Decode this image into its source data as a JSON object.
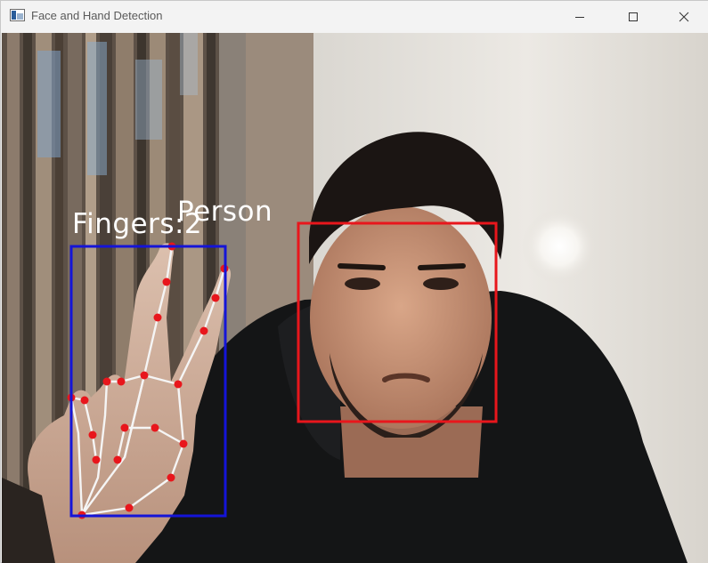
{
  "window": {
    "title": "Face and Hand Detection",
    "controls": {
      "minimize": "minimize-icon",
      "maximize": "maximize-icon",
      "close": "close-icon"
    }
  },
  "detections": {
    "face": {
      "label": "Person",
      "box_color": "#e8161c"
    },
    "hand": {
      "label": "Fingers:2",
      "box_color": "#1414d8",
      "landmark_color": "#e8161c",
      "connection_color": "#f5f5f5"
    }
  }
}
